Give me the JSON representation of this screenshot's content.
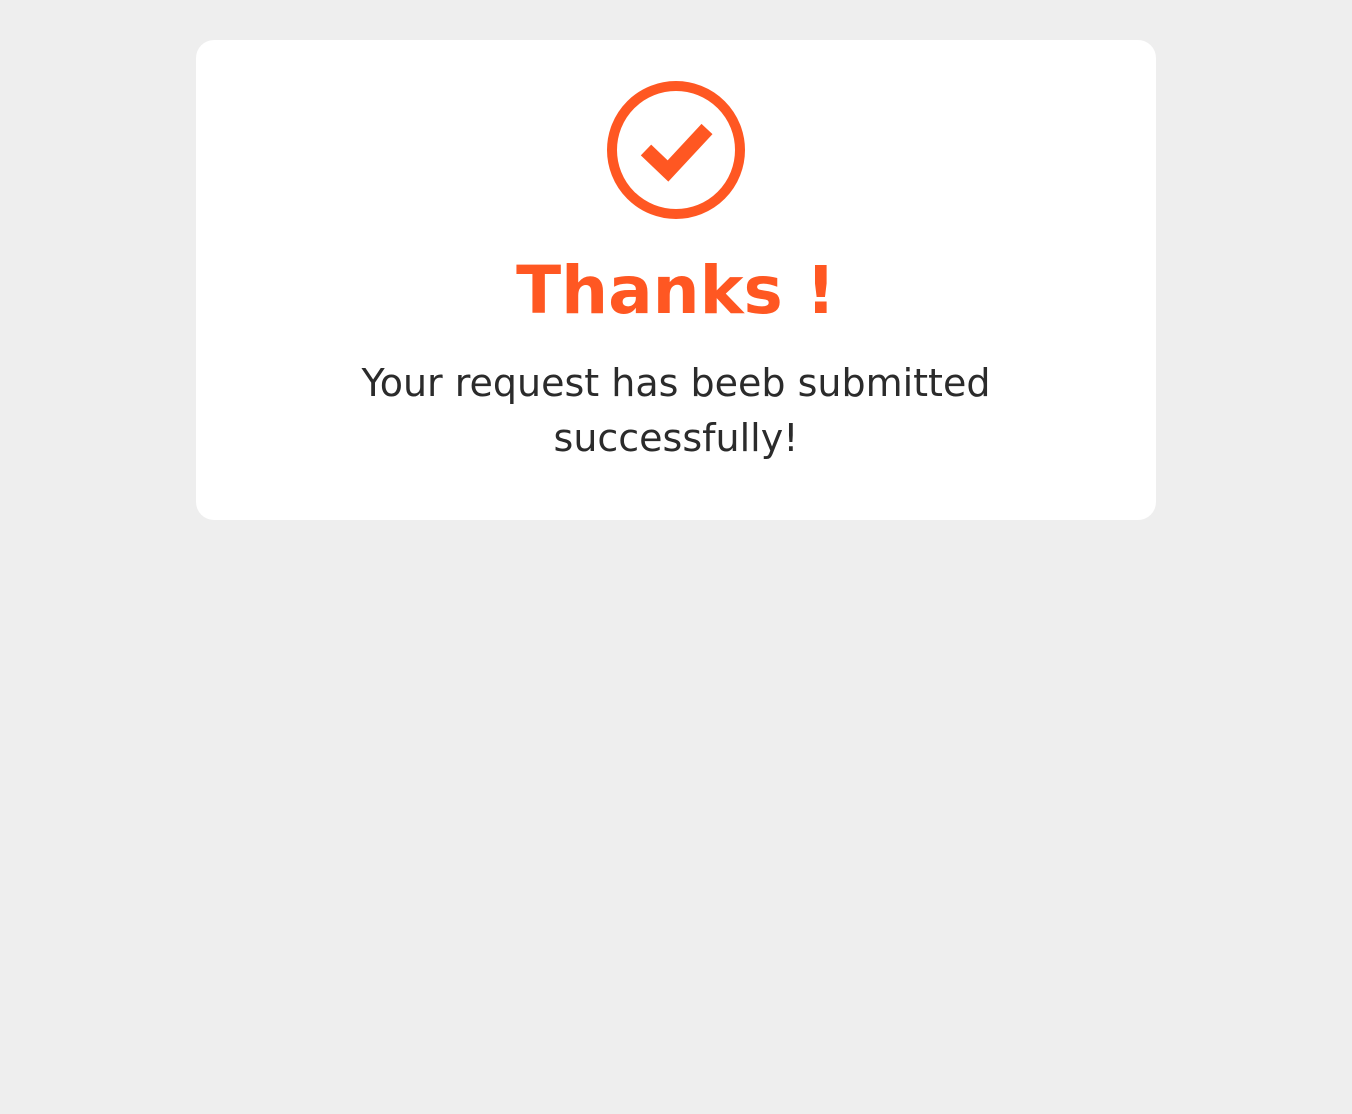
{
  "confirmation": {
    "icon": "check-circle-icon",
    "title": "Thanks !",
    "message": "Your request has beeb submitted successfully!"
  },
  "colors": {
    "accent": "#ff5722",
    "background": "#eeeeee",
    "card": "#ffffff",
    "text": "#2b2b2b"
  }
}
